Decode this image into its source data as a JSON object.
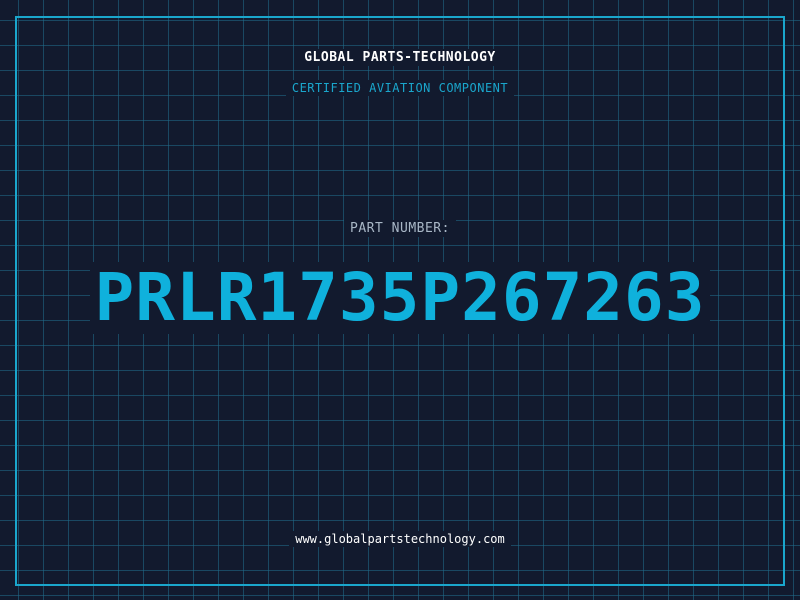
{
  "company_name": "GLOBAL PARTS-TECHNOLOGY",
  "subtitle": "CERTIFIED AVIATION COMPONENT",
  "part_number_label": "PART NUMBER:",
  "part_number": "PRLR1735P267263",
  "website": "www.globalpartstechnology.com",
  "colors": {
    "background": "#121a2e",
    "grid": "#206e8c",
    "accent": "#1aa6cc",
    "part_number": "#0fb1dc",
    "primary_text": "#ffffff",
    "label_text": "#a9b7c6"
  }
}
